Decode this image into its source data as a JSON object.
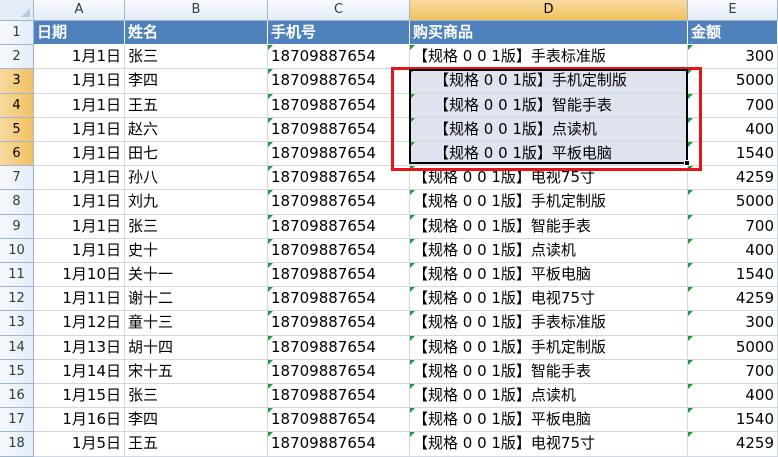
{
  "columns": [
    "A",
    "B",
    "C",
    "D",
    "E"
  ],
  "selected_columns": [
    "D"
  ],
  "selected_rows": [
    3,
    4,
    5,
    6
  ],
  "header_row": {
    "row": "1",
    "cells": [
      "日期",
      "姓名",
      "手机号",
      "购买商品",
      "金额"
    ]
  },
  "rows": [
    {
      "row": "2",
      "date": "1月1日",
      "name": "张三",
      "phone": "18709887654",
      "product": "【规格 0 0 1版】手表标准版",
      "amount": "300"
    },
    {
      "row": "3",
      "date": "1月1日",
      "name": "李四",
      "phone": "18709887654",
      "product": "【规格 0 0 1版】手机定制版",
      "amount": "5000"
    },
    {
      "row": "4",
      "date": "1月1日",
      "name": "王五",
      "phone": "18709887654",
      "product": "【规格 0 0 1版】智能手表",
      "amount": "700"
    },
    {
      "row": "5",
      "date": "1月1日",
      "name": "赵六",
      "phone": "18709887654",
      "product": "【规格 0 0 1版】点读机",
      "amount": "400"
    },
    {
      "row": "6",
      "date": "1月1日",
      "name": "田七",
      "phone": "18709887654",
      "product": "【规格 0 0 1版】平板电脑",
      "amount": "1540"
    },
    {
      "row": "7",
      "date": "1月1日",
      "name": "孙八",
      "phone": "18709887654",
      "product": "【规格 0 0 1版】电视75寸",
      "amount": "4259"
    },
    {
      "row": "8",
      "date": "1月1日",
      "name": "刘九",
      "phone": "18709887654",
      "product": "【规格 0 0 1版】手机定制版",
      "amount": "5000"
    },
    {
      "row": "9",
      "date": "1月1日",
      "name": "张三",
      "phone": "18709887654",
      "product": "【规格 0 0 1版】智能手表",
      "amount": "700"
    },
    {
      "row": "10",
      "date": "1月1日",
      "name": "史十",
      "phone": "18709887654",
      "product": "【规格 0 0 1版】点读机",
      "amount": "400"
    },
    {
      "row": "11",
      "date": "1月10日",
      "name": "关十一",
      "phone": "18709887654",
      "product": "【规格 0 0 1版】平板电脑",
      "amount": "1540"
    },
    {
      "row": "12",
      "date": "1月11日",
      "name": "谢十二",
      "phone": "18709887654",
      "product": "【规格 0 0 1版】电视75寸",
      "amount": "4259"
    },
    {
      "row": "13",
      "date": "1月12日",
      "name": "童十三",
      "phone": "18709887654",
      "product": "【规格 0 0 1版】手表标准版",
      "amount": "300"
    },
    {
      "row": "14",
      "date": "1月13日",
      "name": "胡十四",
      "phone": "18709887654",
      "product": "【规格 0 0 1版】手机定制版",
      "amount": "5000"
    },
    {
      "row": "15",
      "date": "1月14日",
      "name": "宋十五",
      "phone": "18709887654",
      "product": "【规格 0 0 1版】智能手表",
      "amount": "700"
    },
    {
      "row": "16",
      "date": "1月15日",
      "name": "张三",
      "phone": "18709887654",
      "product": "【规格 0 0 1版】点读机",
      "amount": "400"
    },
    {
      "row": "17",
      "date": "1月16日",
      "name": "李四",
      "phone": "18709887654",
      "product": "【规格 0 0 1版】平板电脑",
      "amount": "1540"
    },
    {
      "row": "18",
      "date": "1月5日",
      "name": "王五",
      "phone": "18709887654",
      "product": "【规格 0 0 1版】电视75寸",
      "amount": "4259"
    }
  ],
  "colors": {
    "header_fill": "#4f81bd",
    "header_text": "#ffffff",
    "annotation_box": "#e8141b",
    "selection_fill": "#dfe3ee",
    "error_triangle": "#1f9a3a"
  }
}
